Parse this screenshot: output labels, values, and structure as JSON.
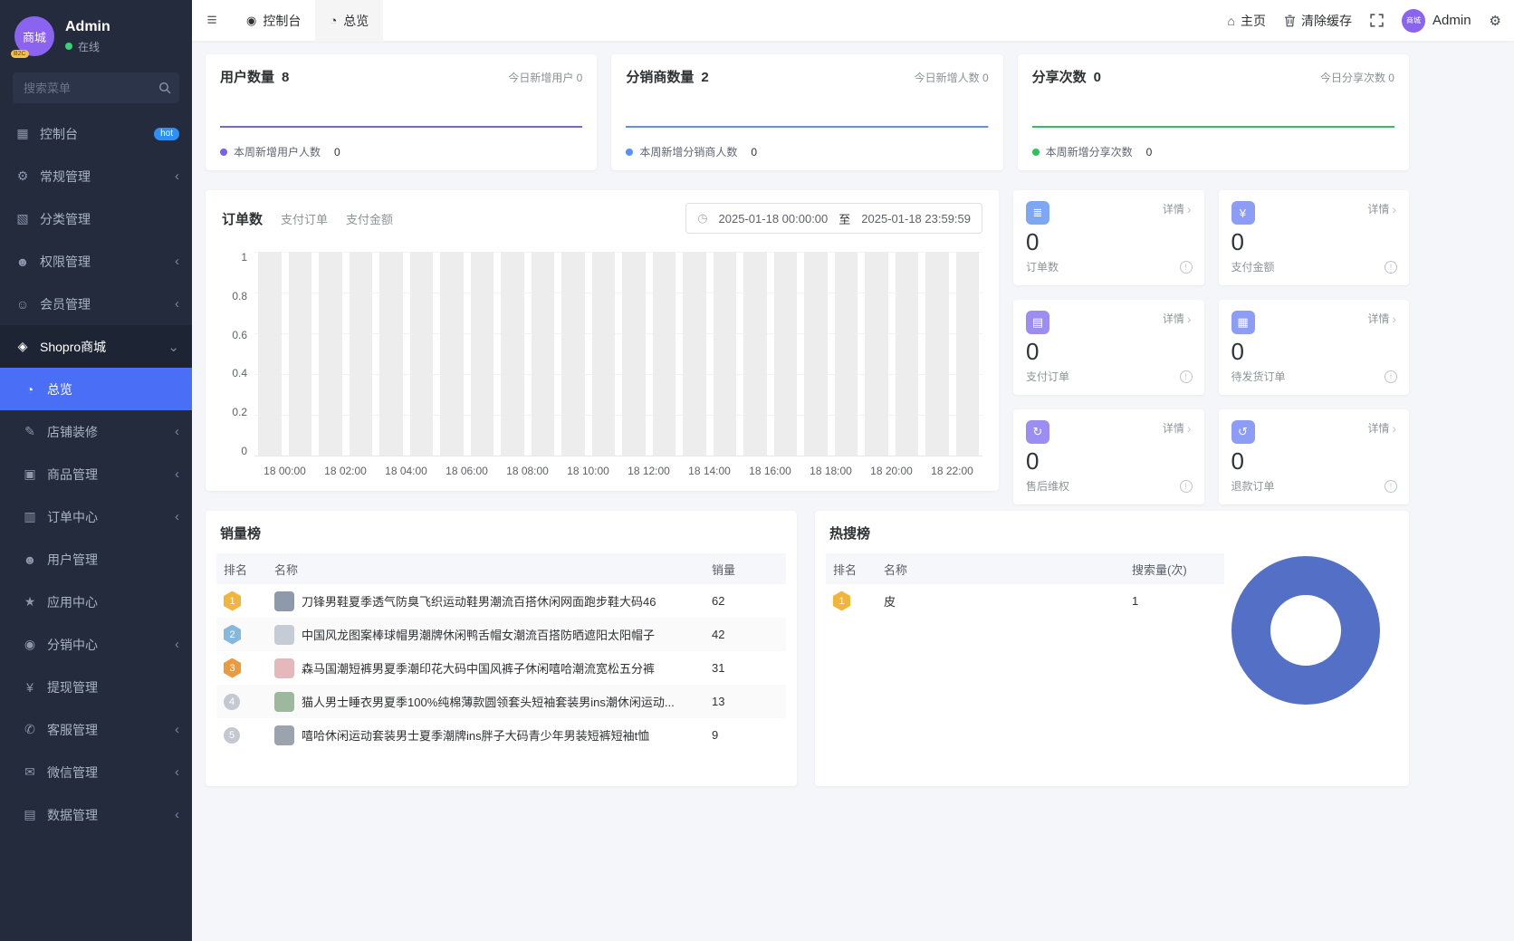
{
  "theme": {
    "primary": "#4a6ef5",
    "sidebar_bg": "#232b3d",
    "content_bg": "#f4f6f9",
    "hot_badge": "#2e90f5"
  },
  "sidebar": {
    "avatar_text": "商城",
    "avatar_badge": "B2C",
    "username": "Admin",
    "status": "在线",
    "search_placeholder": "搜索菜单",
    "items": [
      {
        "label": "控制台",
        "icon": "dashboard-icon",
        "badge": "hot"
      },
      {
        "label": "常规管理",
        "icon": "gear-icon",
        "chevron": true
      },
      {
        "label": "分类管理",
        "icon": "category-icon"
      },
      {
        "label": "权限管理",
        "icon": "permissions-icon",
        "chevron": true
      },
      {
        "label": "会员管理",
        "icon": "member-icon",
        "chevron": true
      },
      {
        "label": "Shopro商城",
        "icon": "shop-icon",
        "expanded": true
      },
      {
        "label": "总览",
        "icon": "overview-icon",
        "active": true,
        "child": true
      },
      {
        "label": "店铺装修",
        "icon": "decorate-icon",
        "chevron": true,
        "child": true
      },
      {
        "label": "商品管理",
        "icon": "goods-icon",
        "chevron": true,
        "child": true
      },
      {
        "label": "订单中心",
        "icon": "order-icon",
        "chevron": true,
        "child": true
      },
      {
        "label": "用户管理",
        "icon": "user-icon",
        "child": true
      },
      {
        "label": "应用中心",
        "icon": "app-icon",
        "child": true
      },
      {
        "label": "分销中心",
        "icon": "distribution-icon",
        "chevron": true,
        "child": true
      },
      {
        "label": "提现管理",
        "icon": "withdraw-icon",
        "child": true
      },
      {
        "label": "客服管理",
        "icon": "service-icon",
        "chevron": true,
        "child": true
      },
      {
        "label": "微信管理",
        "icon": "wechat-icon",
        "chevron": true,
        "child": true
      },
      {
        "label": "数据管理",
        "icon": "data-icon",
        "chevron": true,
        "child": true
      }
    ]
  },
  "header": {
    "tabs": [
      {
        "label": "控制台"
      },
      {
        "label": "总览",
        "active": true
      }
    ],
    "home": "主页",
    "clear_cache": "清除缓存",
    "username": "Admin",
    "avatar_text": "商城"
  },
  "stat_cards": [
    {
      "title": "用户数量",
      "value": "8",
      "today": "今日新增用户 0",
      "week_label": "本周新增用户人数",
      "week_value": "0",
      "color": "#7b5ff0"
    },
    {
      "title": "分销商数量",
      "value": "2",
      "today": "今日新增人数 0",
      "week_label": "本周新增分销商人数",
      "week_value": "0",
      "color": "#5b8ff9"
    },
    {
      "title": "分享次数",
      "value": "0",
      "today": "今日分享次数 0",
      "week_label": "本周新增分享次数",
      "week_value": "0",
      "color": "#2fc25b"
    }
  ],
  "order_panel": {
    "title": "订单数",
    "tabs": [
      "支付订单",
      "支付金额"
    ],
    "date_from": "2025-01-18 00:00:00",
    "date_separator": "至",
    "date_to": "2025-01-18 23:59:59"
  },
  "mini_cards": [
    {
      "label": "订单数",
      "value": "0",
      "link": "详情",
      "icon": "order-count-icon",
      "icon_color": "#7da7f2"
    },
    {
      "label": "支付金额",
      "value": "0",
      "link": "详情",
      "icon": "pay-amount-icon",
      "icon_color": "#8d9cf4"
    },
    {
      "label": "支付订单",
      "value": "0",
      "link": "详情",
      "icon": "pay-order-icon",
      "icon_color": "#9c8df2"
    },
    {
      "label": "待发货订单",
      "value": "0",
      "link": "详情",
      "icon": "ship-order-icon",
      "icon_color": "#8d9cf4"
    },
    {
      "label": "售后维权",
      "value": "0",
      "link": "详情",
      "icon": "aftersale-icon",
      "icon_color": "#9c8df2"
    },
    {
      "label": "退款订单",
      "value": "0",
      "link": "详情",
      "icon": "refund-icon",
      "icon_color": "#8d9cf4"
    }
  ],
  "sales": {
    "title": "销量榜",
    "headers": [
      "排名",
      "名称",
      "销量"
    ],
    "rows": [
      {
        "rank": "1",
        "medal_shape": "hex",
        "medal_color": "#f2b53c",
        "thumb_color": "#8e99ac",
        "name": "刀锋男鞋夏季透气防臭飞织运动鞋男潮流百搭休闲网面跑步鞋大码46",
        "value": "62"
      },
      {
        "rank": "2",
        "medal_shape": "hex",
        "medal_color": "#86b8dd",
        "thumb_color": "#c6ccd6",
        "name": "中国风龙图案棒球帽男潮牌休闲鸭舌帽女潮流百搭防晒遮阳太阳帽子",
        "value": "42"
      },
      {
        "rank": "3",
        "medal_shape": "hex",
        "medal_color": "#ec9a3e",
        "thumb_color": "#e5b9bc",
        "name": "森马国潮短裤男夏季潮印花大码中国风裤子休闲嘻哈潮流宽松五分裤",
        "value": "31"
      },
      {
        "rank": "4",
        "medal_shape": "circle",
        "medal_color": "#c3c8d1",
        "thumb_color": "#9db89f",
        "name": "猫人男士睡衣男夏季100%纯棉薄款圆领套头短袖套装男ins潮休闲运动...",
        "value": "13"
      },
      {
        "rank": "5",
        "medal_shape": "circle",
        "medal_color": "#c3c8d1",
        "thumb_color": "#9ba3ae",
        "name": "嘻哈休闲运动套装男士夏季潮牌ins胖子大码青少年男装短裤短袖t恤",
        "value": "9"
      }
    ]
  },
  "hot_search": {
    "title": "热搜榜",
    "headers": [
      "排名",
      "名称",
      "搜索量(次)"
    ],
    "rows": [
      {
        "rank": "1",
        "medal_shape": "hex",
        "medal_color": "#f2b53c",
        "name": "皮",
        "value": "1"
      }
    ],
    "donut_color": "#5470c6"
  },
  "chart_data": [
    {
      "type": "bar",
      "title": "订单数",
      "categories": [
        "18 00:00",
        "18 01:00",
        "18 02:00",
        "18 03:00",
        "18 04:00",
        "18 05:00",
        "18 06:00",
        "18 07:00",
        "18 08:00",
        "18 09:00",
        "18 10:00",
        "18 11:00",
        "18 12:00",
        "18 13:00",
        "18 14:00",
        "18 15:00",
        "18 16:00",
        "18 17:00",
        "18 18:00",
        "18 19:00",
        "18 20:00",
        "18 21:00",
        "18 22:00",
        "18 23:00"
      ],
      "values": [
        0,
        0,
        0,
        0,
        0,
        0,
        0,
        0,
        0,
        0,
        0,
        0,
        0,
        0,
        0,
        0,
        0,
        0,
        0,
        0,
        0,
        0,
        0,
        0
      ],
      "x_tick_labels": [
        "18 00:00",
        "18 02:00",
        "18 04:00",
        "18 06:00",
        "18 08:00",
        "18 10:00",
        "18 12:00",
        "18 14:00",
        "18 16:00",
        "18 18:00",
        "18 20:00",
        "18 22:00"
      ],
      "ylim": [
        0,
        1
      ],
      "yticks": [
        0,
        0.2,
        0.4,
        0.6,
        0.8,
        1
      ],
      "background_bars": true,
      "bar_color": "#ededed",
      "grid": true,
      "legend_position": "none"
    },
    {
      "type": "pie",
      "title": "热搜榜",
      "labels": [
        "皮"
      ],
      "values": [
        1
      ],
      "donut": true,
      "colors": [
        "#5470c6"
      ]
    }
  ]
}
